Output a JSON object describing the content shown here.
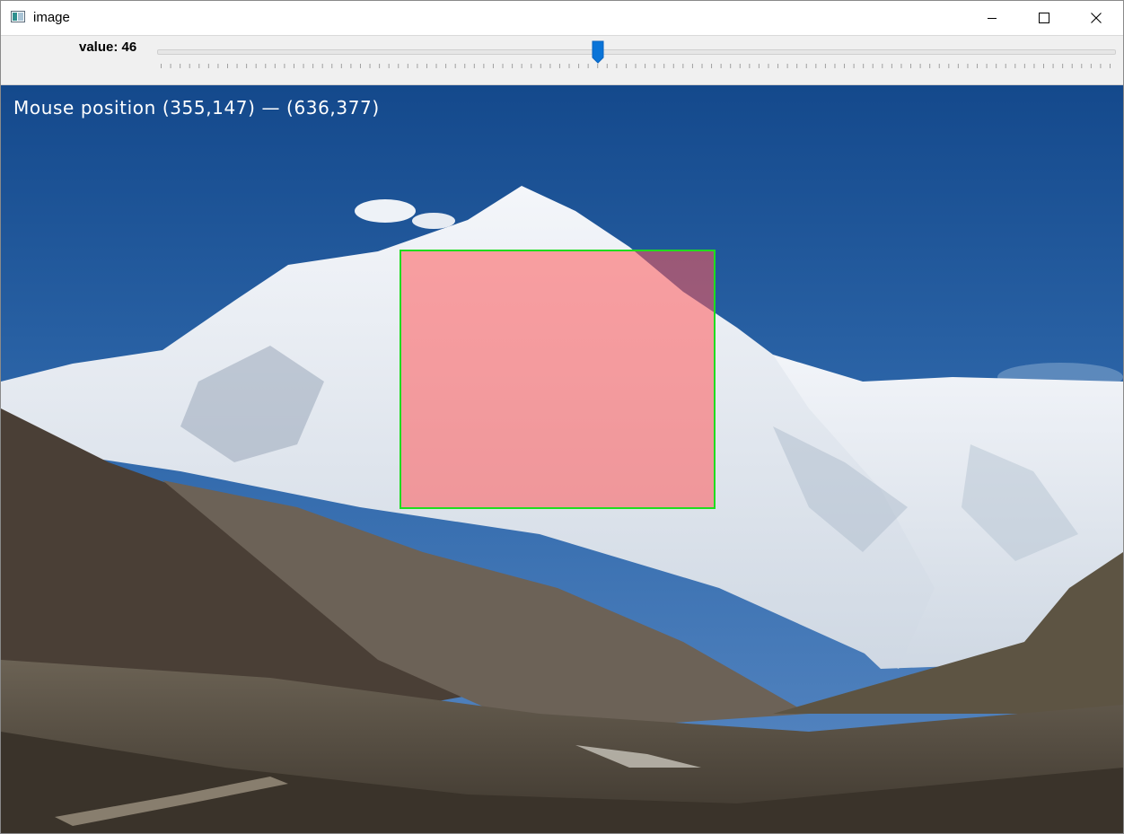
{
  "window": {
    "title": "image",
    "title_icon": "app-image-icon",
    "controls": [
      "minimize-icon",
      "maximize-icon",
      "close-icon"
    ]
  },
  "trackbar": {
    "label": "value: 46",
    "value": 46,
    "min": 0,
    "max": 100,
    "thumb_color": "#0a74d8"
  },
  "canvas": {
    "overlay_text": "Mouse position (355,147) — (636,377)",
    "selection": {
      "border_color": "#1fdc1f",
      "fill_color": "#ff5a5a"
    }
  }
}
